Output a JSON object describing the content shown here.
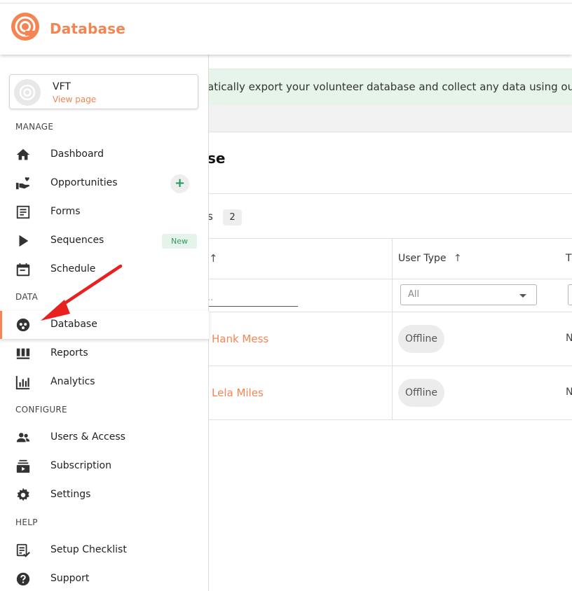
{
  "header": {
    "brand": "Database",
    "brand_color": "#f58453"
  },
  "banner": {
    "text": "atically export your volunteer database and collect any data using ou"
  },
  "main": {
    "title_fragment": "se",
    "tab_fragment": "s",
    "tab_count": "2",
    "table": {
      "user_type_header": "User Type",
      "third_header_fragment": "T",
      "name_filter_placeholder": "..",
      "user_type_filter_value": "All",
      "rows": [
        {
          "name": "Hank Mess",
          "status": "Offline",
          "edge": "N"
        },
        {
          "name": "Lela Miles",
          "status": "Offline",
          "edge": "N"
        }
      ]
    }
  },
  "sidebar": {
    "profile": {
      "name": "VFT",
      "link": "View page"
    },
    "sections": {
      "manage": "MANAGE",
      "data": "DATA",
      "configure": "CONFIGURE",
      "help": "HELP"
    },
    "items": [
      {
        "label": "Dashboard",
        "icon": "home-icon"
      },
      {
        "label": "Opportunities",
        "icon": "hand-heart-icon",
        "action": "+"
      },
      {
        "label": "Forms",
        "icon": "form-icon"
      },
      {
        "label": "Sequences",
        "icon": "play-icon",
        "badge": "New"
      },
      {
        "label": "Schedule",
        "icon": "calendar-icon"
      },
      {
        "label": "Database",
        "icon": "database-icon",
        "active": true
      },
      {
        "label": "Reports",
        "icon": "reports-icon"
      },
      {
        "label": "Analytics",
        "icon": "analytics-icon"
      },
      {
        "label": "Users & Access",
        "icon": "users-icon"
      },
      {
        "label": "Subscription",
        "icon": "subscription-icon"
      },
      {
        "label": "Settings",
        "icon": "gear-icon"
      },
      {
        "label": "Setup Checklist",
        "icon": "checklist-icon"
      },
      {
        "label": "Support",
        "icon": "help-icon"
      }
    ]
  },
  "colors": {
    "accent": "#f58453",
    "success": "#1e9a5a",
    "annotation_arrow": "#e8201e"
  }
}
